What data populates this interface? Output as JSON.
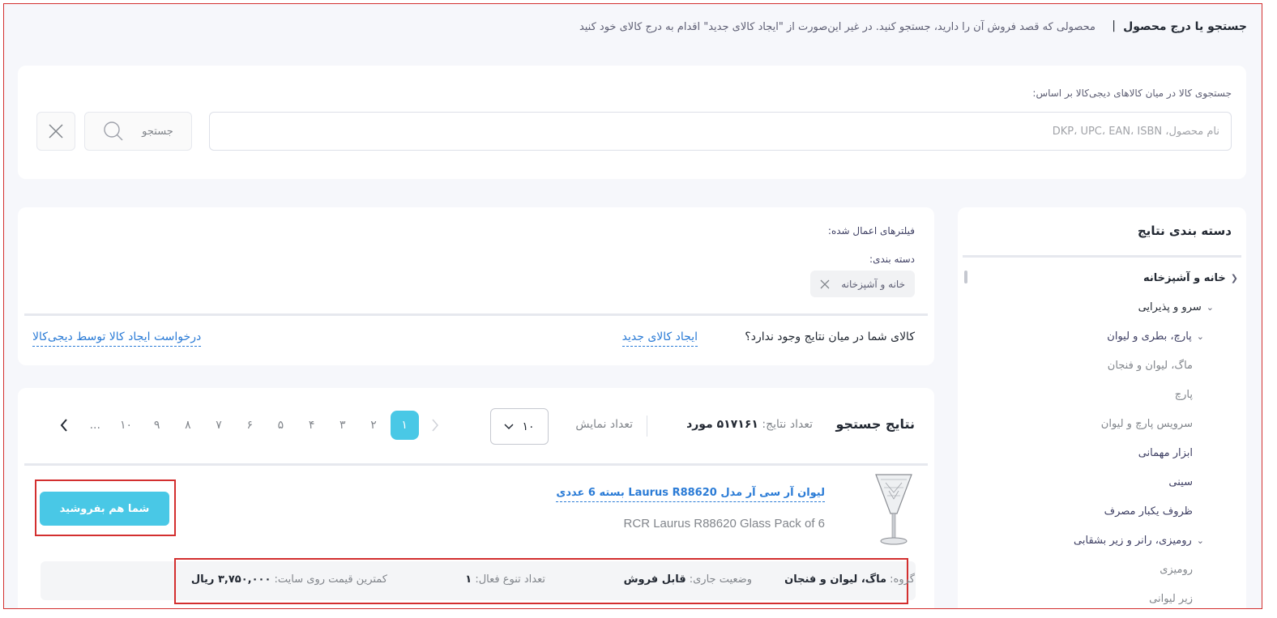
{
  "header": {
    "title": "جستجو یا درج محصول",
    "separator": "|",
    "description": "محصولی که قصد فروش آن را دارید، جستجو کنید. در غیر این‌صورت از \"ایجاد کالای جدید\" اقدام به درج کالای خود کنید"
  },
  "search": {
    "label": "جستجوی کالا در میان کالاهای دیجی‌کالا بر اساس:",
    "placeholder": "نام محصول، DKP، UPC، EAN، ISBN",
    "value": "",
    "button_label": "جستجو",
    "icons": {
      "search": "search-icon",
      "clear": "close-icon"
    }
  },
  "sidebar": {
    "title": "دسته بندی نتایج",
    "items": [
      {
        "label": "خانه و آشپزخانه",
        "icon": "chevron-left-icon"
      },
      {
        "label": "سرو و پذیرایی",
        "icon": "chevron-down-icon"
      },
      {
        "label": "پارچ، بطری و لیوان",
        "icon": "chevron-down-icon"
      },
      {
        "label": "ماگ، لیوان و فنجان"
      },
      {
        "label": "پارچ"
      },
      {
        "label": "سرویس پارچ و لیوان"
      },
      {
        "label": "ابزار مهمانی"
      },
      {
        "label": "سینی"
      },
      {
        "label": "ظروف یکبار مصرف"
      },
      {
        "label": "رومیزی، رانر و زیر بشقابی",
        "icon": "chevron-down-icon"
      },
      {
        "label": "رومیزی"
      },
      {
        "label": "زیر لیوانی"
      }
    ]
  },
  "filters": {
    "title": "فیلترهای اعمال شده:",
    "category_label": "دسته بندی:",
    "chip_label": "خانه و آشپزخانه",
    "missing_question": "کالای شما در میان نتایج وجود ندارد؟",
    "create_link": "ایجاد کالای جدید",
    "request_link": "درخواست ایجاد کالا توسط دیجی‌کالا"
  },
  "results": {
    "title": "نتایج جستجو",
    "count_label": "تعداد نتایج:",
    "count_value": "۵۱۷۱۶۱ مورد",
    "per_page_label": "تعداد نمایش",
    "per_page_value": "۱۰",
    "pagination": {
      "pages": [
        "۱",
        "۲",
        "۳",
        "۴",
        "۵",
        "۶",
        "۷",
        "۸",
        "۹",
        "۱۰"
      ],
      "current": "۱",
      "ellipsis": "..."
    },
    "accent_color": "#49c8e6"
  },
  "product": {
    "title": "لیوان آر سی آر مدل Laurus R88620 بسته 6 عددی",
    "subtitle": "RCR Laurus R88620 Glass Pack of 6",
    "sell_button": "شما هم بفروشید",
    "group_label": "گروه:",
    "group_value": "ماگ، لیوان و فنجان",
    "status_label": "وضعیت جاری:",
    "status_value": "قابل فروش",
    "variants_label": "تعداد تنوع فعال:",
    "variants_value": "۱",
    "min_price_label": "کمترین قیمت روی سایت:",
    "min_price_value": "۳,۷۵۰,۰۰۰ ریال"
  }
}
